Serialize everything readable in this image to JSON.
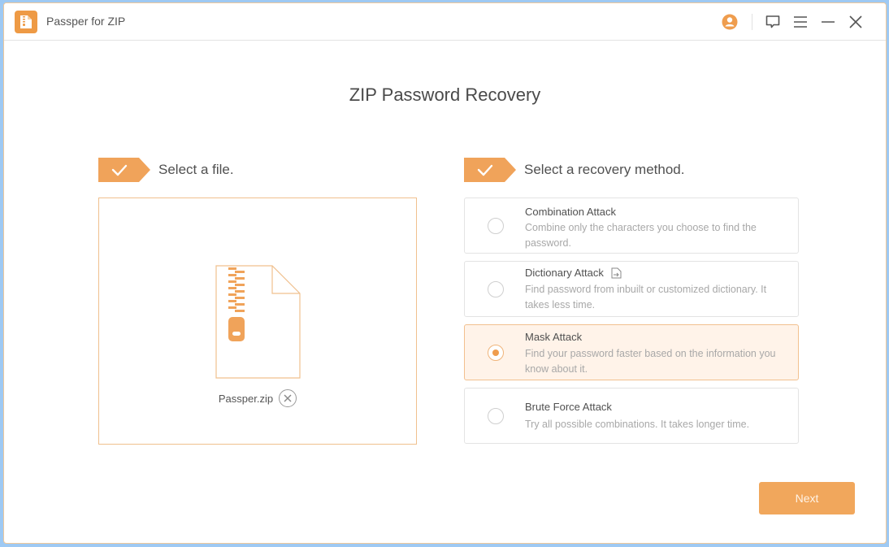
{
  "app": {
    "title": "Passper for ZIP",
    "accent_color": "#f0a35a",
    "titlebar_icons": [
      "account-icon",
      "feedback-icon",
      "menu-icon",
      "minimize-icon",
      "close-icon"
    ]
  },
  "main": {
    "title": "ZIP Password Recovery",
    "steps": [
      {
        "label": "Select a file.",
        "icon": "check-icon",
        "completed": true
      },
      {
        "label": "Select a recovery method.",
        "icon": "check-icon",
        "completed": true
      }
    ],
    "file": {
      "name": "Passper.zip",
      "icon": "zip-file-icon",
      "remove_icon": "remove-circle-icon"
    },
    "methods": [
      {
        "title": "Combination Attack",
        "description": "Combine only the characters you choose to find the password.",
        "selected": false
      },
      {
        "title": "Dictionary Attack",
        "description": "Find password from inbuilt or customized dictionary. It takes less time.",
        "selected": false,
        "extra_icon": "import-file-icon"
      },
      {
        "title": "Mask Attack",
        "description": "Find your password faster based on the information you know about it.",
        "selected": true
      },
      {
        "title": "Brute Force Attack",
        "description": "Try all possible combinations. It takes longer time.",
        "selected": false
      }
    ],
    "next_label": "Next"
  }
}
